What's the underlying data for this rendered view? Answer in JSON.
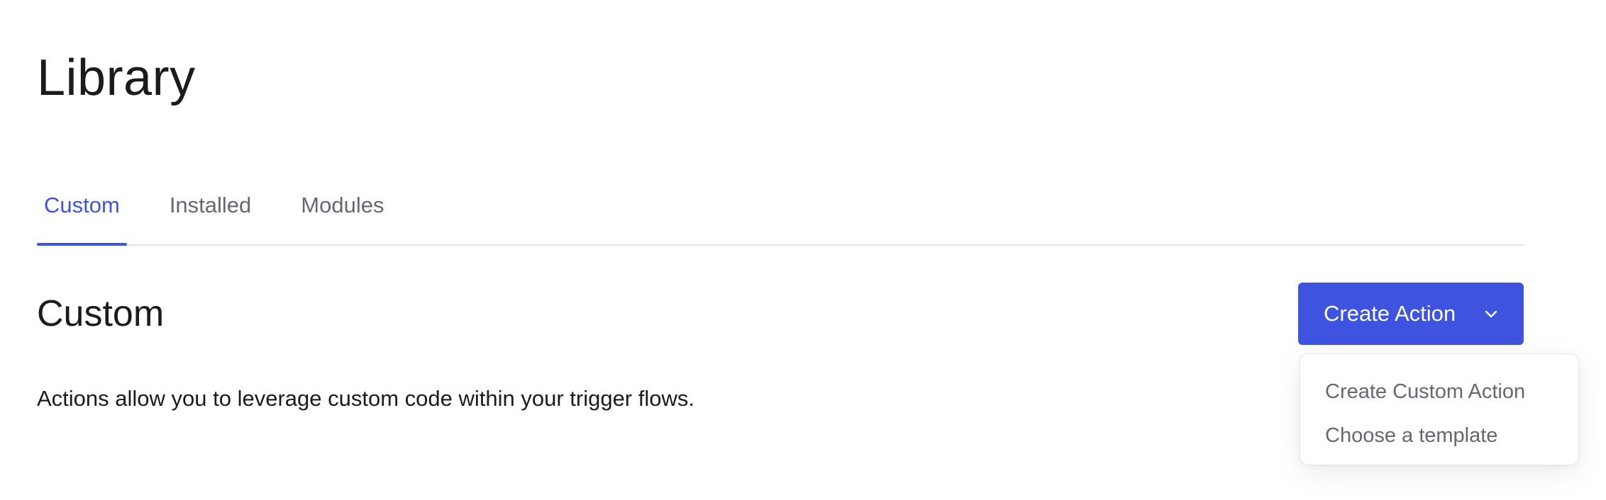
{
  "header": {
    "title": "Library"
  },
  "tabs": [
    {
      "label": "Custom",
      "active": true
    },
    {
      "label": "Installed",
      "active": false
    },
    {
      "label": "Modules",
      "active": false
    }
  ],
  "section": {
    "title": "Custom",
    "description": "Actions allow you to leverage custom code within your trigger flows."
  },
  "create_action": {
    "label": "Create Action",
    "icon": "chevron-down-icon",
    "menu": [
      {
        "label": "Create Custom Action"
      },
      {
        "label": "Choose a template"
      }
    ]
  },
  "colors": {
    "accent": "#3e54e0",
    "text": "#1b1b1b",
    "muted_text": "#676770",
    "divider": "#e3e3e6"
  }
}
